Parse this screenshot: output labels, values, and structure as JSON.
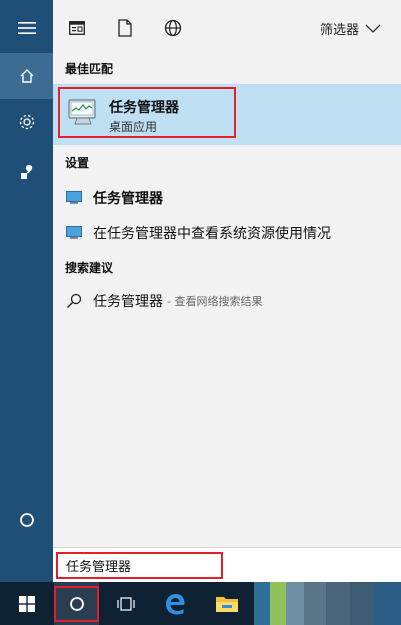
{
  "toolbar": {
    "icons": [
      "app-icon",
      "document-icon",
      "globe-icon"
    ],
    "filter_label": "筛选器"
  },
  "sections": {
    "best_match": "最佳匹配",
    "settings": "设置",
    "search_suggestions": "搜索建议"
  },
  "best_match": {
    "title": "任务管理器",
    "subtitle": "桌面应用"
  },
  "settings_items": [
    {
      "label": "任务管理器"
    },
    {
      "label": "在任务管理器中查看系统资源使用情况"
    }
  ],
  "suggestion": {
    "label": "任务管理器",
    "hint": "- 查看网络搜索结果"
  },
  "search": {
    "value": "任务管理器"
  },
  "colors": {
    "rail": "#1f4f77",
    "rail_active": "#3d6c92",
    "highlight": "#bfdff2",
    "annotation": "#e0202a",
    "taskbar": "#0f2234"
  }
}
